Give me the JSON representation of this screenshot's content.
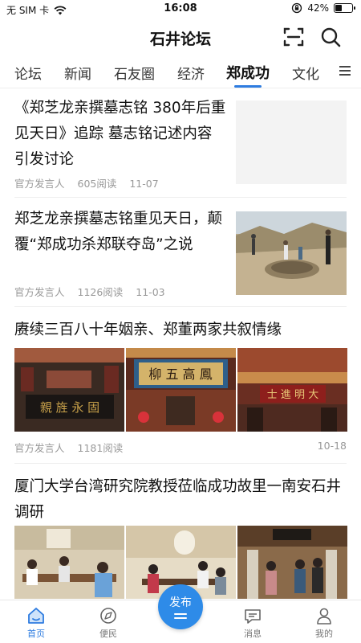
{
  "status_bar": {
    "carrier": "无 SIM 卡",
    "time": "16:08",
    "battery_text": "42%",
    "battery_level": 0.42
  },
  "header": {
    "title": "石井论坛",
    "icons": [
      "scan-icon",
      "search-icon"
    ]
  },
  "tabs": {
    "items": [
      "论坛",
      "新闻",
      "石友圈",
      "经济",
      "郑成功",
      "文化"
    ],
    "active": "郑成功",
    "accent_color": "#2e7ce0"
  },
  "feed": [
    {
      "title": "《郑芝龙亲撰墓志铭 380年后重见天日》追踪 墓志铭记述内容引发讨论",
      "author": "官方发言人",
      "reads": "605阅读",
      "date": "11-07"
    },
    {
      "title": "郑芝龙亲撰墓志铭重见天日，颠覆“郑成功杀郑联夺岛”之说",
      "author": "官方发言人",
      "reads": "1126阅读",
      "date": "11-03"
    },
    {
      "title": "赓续三百八十年姻亲、郑董两家共叙情缘",
      "author": "官方发言人",
      "reads": "1181阅读",
      "date": "10-18",
      "image_texts": [
        "親 旌 永 固",
        "柳 五 高 鳳",
        "士 進 明 大"
      ]
    },
    {
      "title": "厦门大学台湾研究院教授莅临成功故里一南安石井调研"
    }
  ],
  "bottom_nav": {
    "items": [
      {
        "label": "首页",
        "icon": "home-icon"
      },
      {
        "label": "便民",
        "icon": "compass-icon"
      },
      {
        "label": "消息",
        "icon": "message-icon"
      },
      {
        "label": "我的",
        "icon": "user-icon"
      }
    ],
    "publish_label": "发布",
    "active": "首页",
    "accent_color": "#2e8be8"
  }
}
